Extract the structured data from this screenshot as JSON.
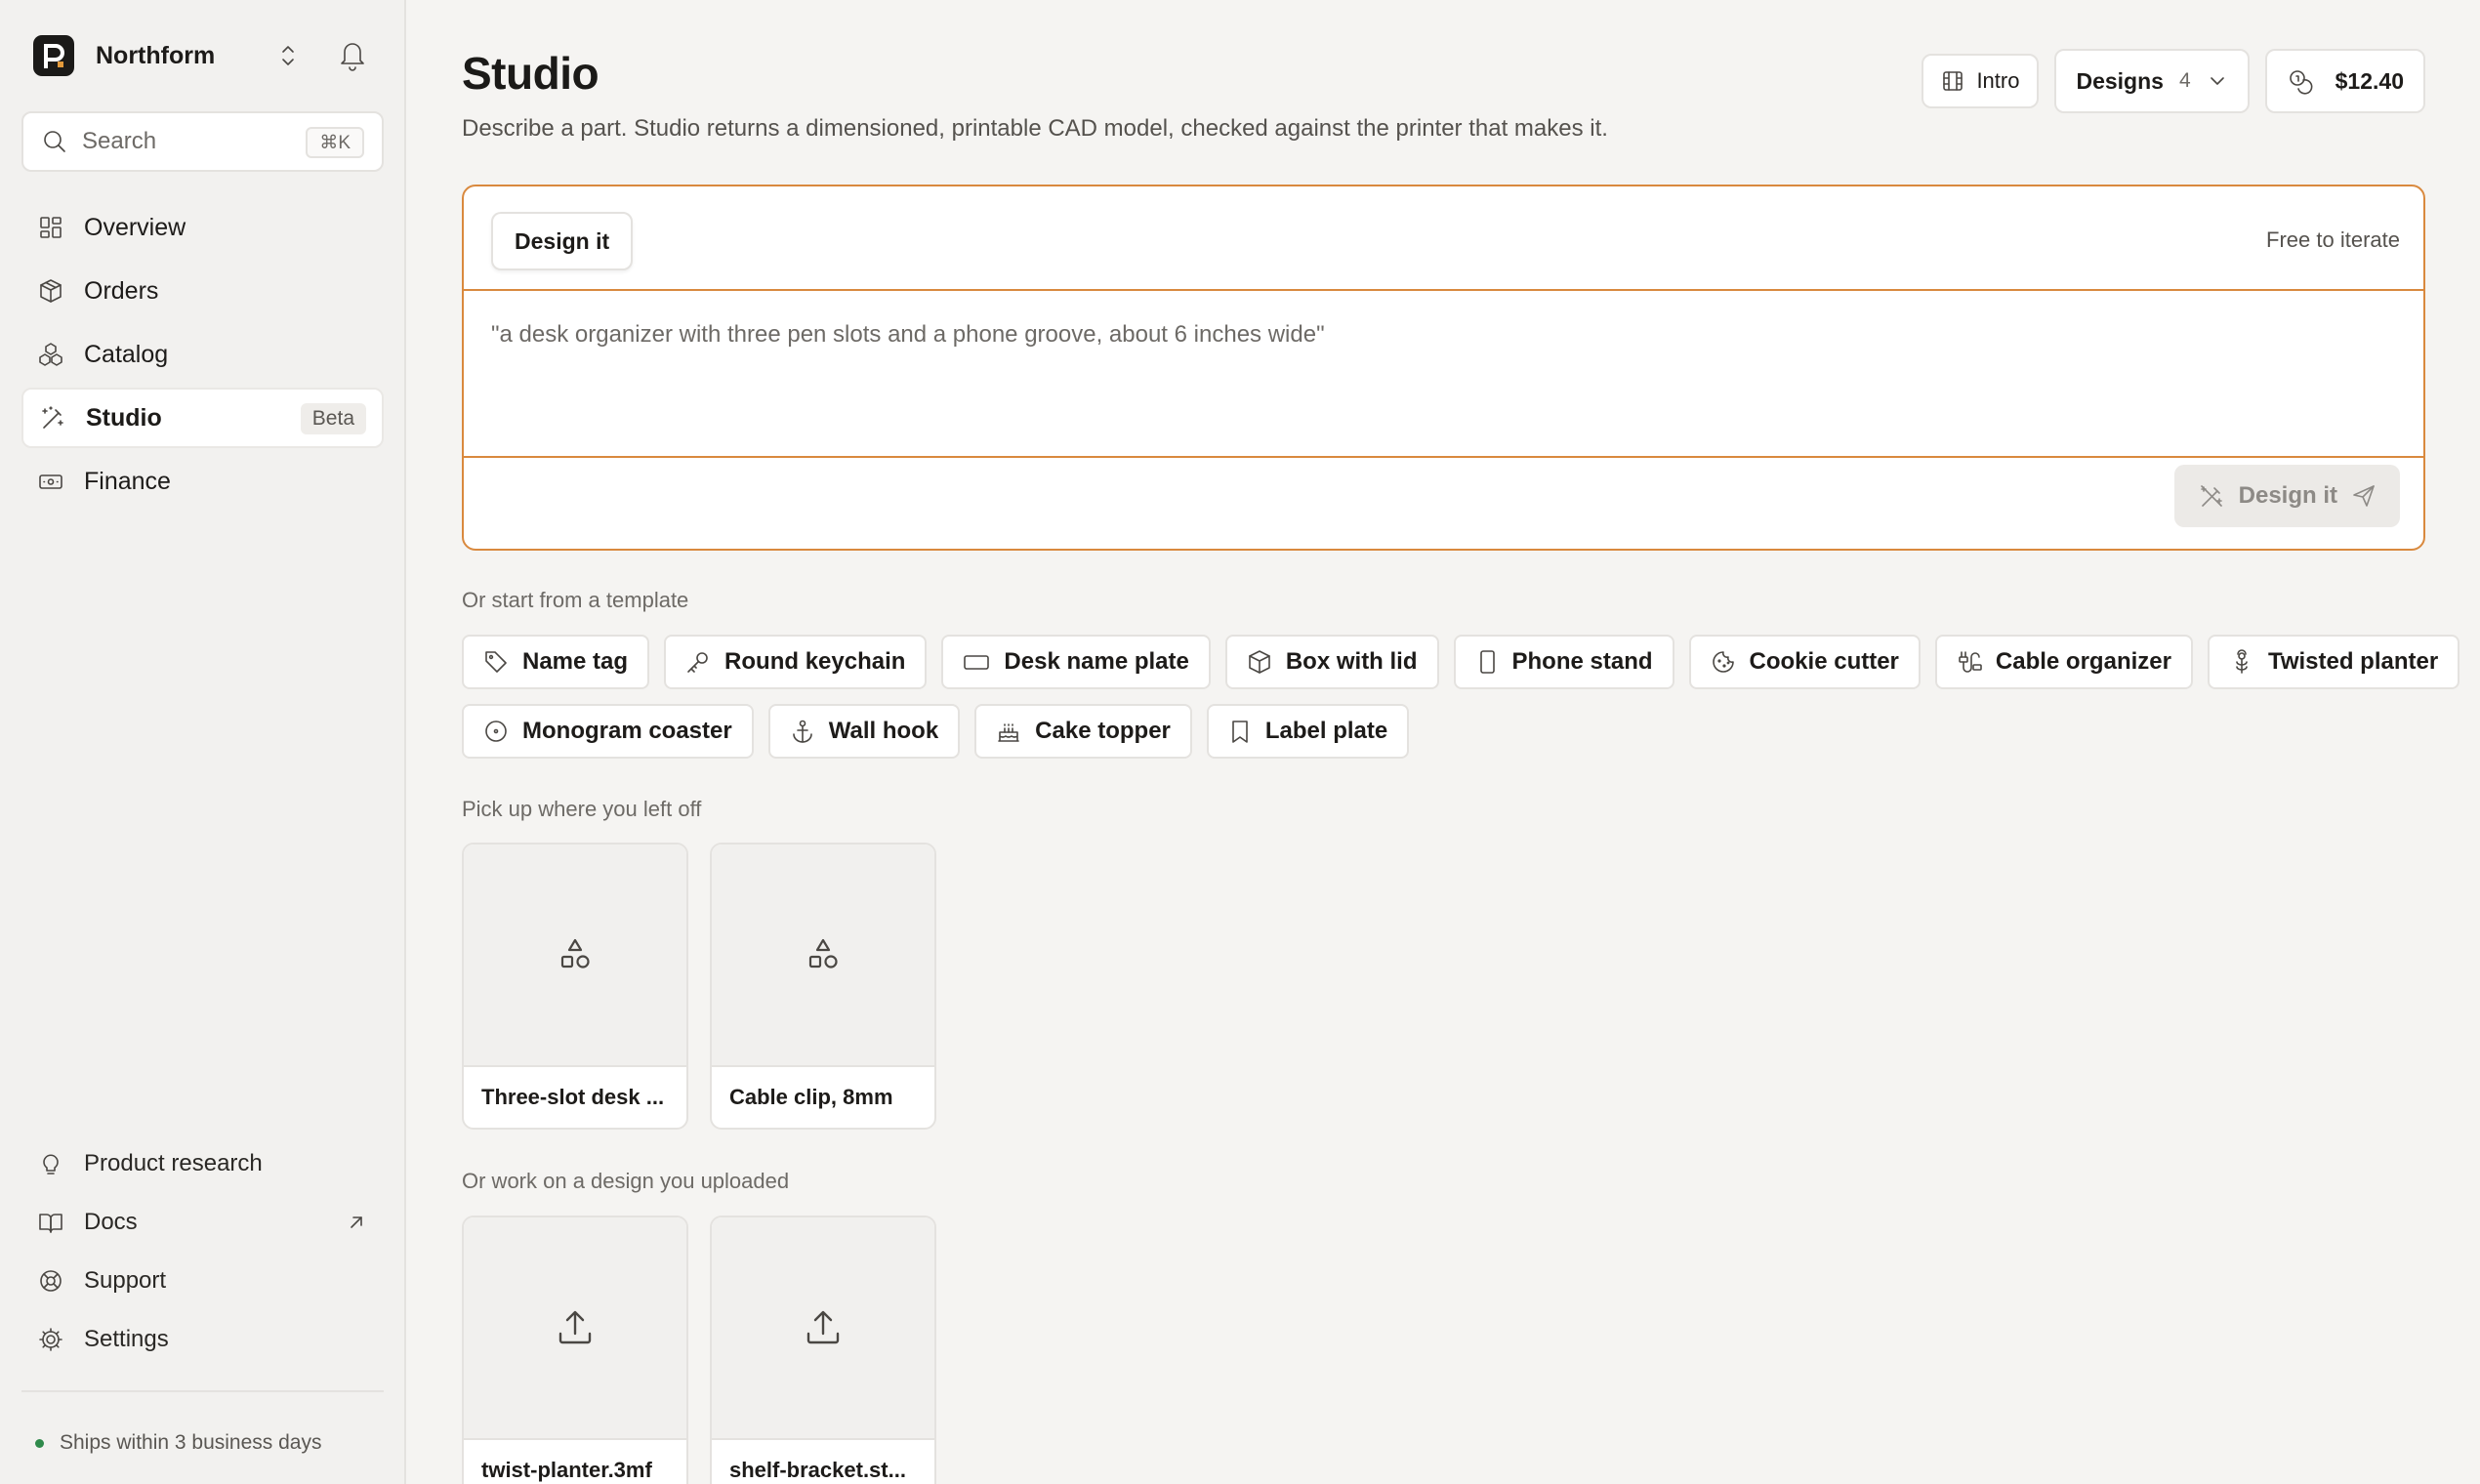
{
  "brand": {
    "name": "Northform"
  },
  "search": {
    "placeholder": "Search",
    "shortcut": "⌘K"
  },
  "nav": {
    "items": [
      {
        "label": "Overview",
        "icon": "grid-icon"
      },
      {
        "label": "Orders",
        "icon": "package-icon"
      },
      {
        "label": "Catalog",
        "icon": "boxes-icon"
      },
      {
        "label": "Studio",
        "icon": "wand-icon",
        "badge": "Beta",
        "active": true
      },
      {
        "label": "Finance",
        "icon": "banknote-icon"
      }
    ]
  },
  "bottom_nav": {
    "items": [
      {
        "label": "Product research",
        "icon": "lightbulb-icon"
      },
      {
        "label": "Docs",
        "icon": "book-icon"
      },
      {
        "label": "Support",
        "icon": "lifebuoy-icon"
      },
      {
        "label": "Settings",
        "icon": "gear-icon"
      }
    ]
  },
  "status": {
    "ships": "Ships within 3 business days",
    "color": "#2f8a4b"
  },
  "header": {
    "title": "Studio",
    "subtitle": "Describe a part. Studio returns a dimensioned, printable CAD model, checked against the printer that makes it.",
    "intro_label": "Intro",
    "designs_label": "Designs",
    "designs_count": "4",
    "balance": "$12.40"
  },
  "composer": {
    "mode_tab": "Design it",
    "pricing_note": "Free to iterate",
    "prompt_text": "\"a desk organizer with three pen slots and a phone groove, about 6 inches wide\"",
    "submit_label": "Design it",
    "accent": "#d9893e"
  },
  "templates": {
    "label": "Or start from a template",
    "items": [
      {
        "label": "Name tag",
        "icon": "tag-icon"
      },
      {
        "label": "Round keychain",
        "icon": "key-icon"
      },
      {
        "label": "Desk name plate",
        "icon": "rectangle-icon"
      },
      {
        "label": "Box with lid",
        "icon": "box-icon"
      },
      {
        "label": "Phone stand",
        "icon": "phone-icon"
      },
      {
        "label": "Cookie cutter",
        "icon": "cookie-icon"
      },
      {
        "label": "Cable organizer",
        "icon": "cable-icon"
      },
      {
        "label": "Twisted planter",
        "icon": "flower-icon"
      },
      {
        "label": "Monogram coaster",
        "icon": "circle-icon"
      },
      {
        "label": "Wall hook",
        "icon": "anchor-icon"
      },
      {
        "label": "Cake topper",
        "icon": "cake-icon"
      },
      {
        "label": "Label plate",
        "icon": "bookmark-icon"
      }
    ]
  },
  "recent": {
    "label": "Pick up where you left off",
    "items": [
      {
        "title": "Three-slot desk ..."
      },
      {
        "title": "Cable clip, 8mm"
      }
    ]
  },
  "uploads": {
    "label": "Or work on a design you uploaded",
    "items": [
      {
        "title": "twist-planter.3mf"
      },
      {
        "title": "shelf-bracket.st..."
      }
    ]
  }
}
